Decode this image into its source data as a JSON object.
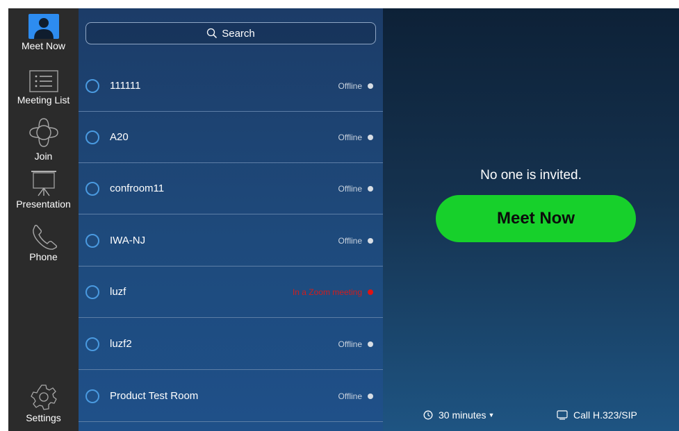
{
  "nav": {
    "items": [
      {
        "label": "Meet Now",
        "icon": "person-icon"
      },
      {
        "label": "Meeting List",
        "icon": "list-icon"
      },
      {
        "label": "Join",
        "icon": "join-icon"
      },
      {
        "label": "Presentation",
        "icon": "presentation-icon"
      },
      {
        "label": "Phone",
        "icon": "phone-icon"
      }
    ],
    "settings": {
      "label": "Settings",
      "icon": "gear-icon"
    }
  },
  "search": {
    "label": "Search"
  },
  "contacts": [
    {
      "name": "111111",
      "status": "Offline"
    },
    {
      "name": "A20",
      "status": "Offline"
    },
    {
      "name": "confroom11",
      "status": "Offline"
    },
    {
      "name": "IWA-NJ",
      "status": "Offline"
    },
    {
      "name": "luzf",
      "status": "In a Zoom meeting"
    },
    {
      "name": "luzf2",
      "status": "Offline"
    },
    {
      "name": "Product Test Room",
      "status": "Offline"
    }
  ],
  "main": {
    "empty_text": "No one is invited.",
    "meet_now_label": "Meet Now",
    "duration": "30 minutes",
    "call_label": "Call H.323/SIP"
  },
  "colors": {
    "accent_green": "#17d02b",
    "busy_red": "#e01313",
    "nav_active_blue": "#2d8cf0"
  }
}
